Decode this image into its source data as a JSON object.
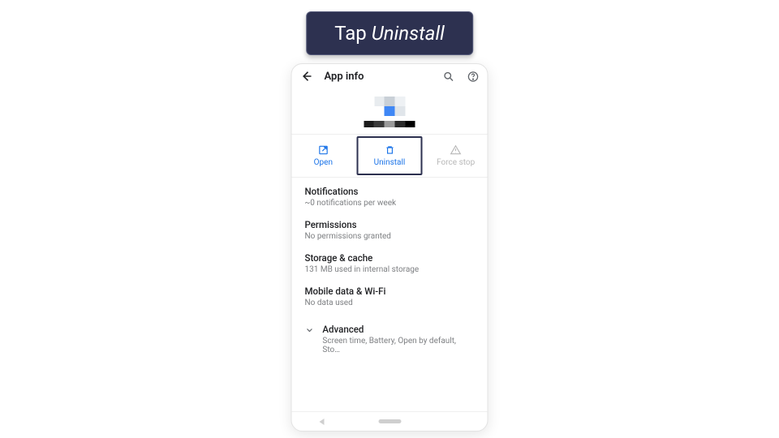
{
  "instruction": {
    "prefix": "Tap ",
    "target": "Uninstall"
  },
  "topbar": {
    "title": "App info"
  },
  "actions": {
    "open": "Open",
    "uninstall": "Uninstall",
    "force_stop": "Force stop"
  },
  "settings": {
    "notifications": {
      "title": "Notifications",
      "sub": "~0 notifications per week"
    },
    "permissions": {
      "title": "Permissions",
      "sub": "No permissions granted"
    },
    "storage": {
      "title": "Storage & cache",
      "sub": "131 MB used in internal storage"
    },
    "data": {
      "title": "Mobile data & Wi-Fi",
      "sub": "No data used"
    },
    "advanced": {
      "title": "Advanced",
      "sub": "Screen time, Battery, Open by default, Sto…"
    }
  }
}
